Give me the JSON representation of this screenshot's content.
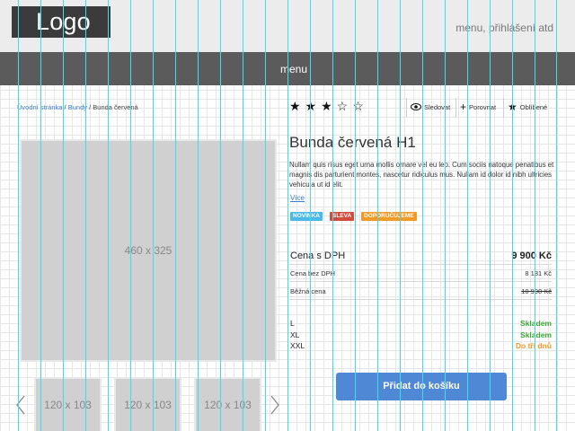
{
  "header": {
    "logo": "Logo",
    "right_text": "menu, přihlášení atd"
  },
  "menu": {
    "label": "menu"
  },
  "breadcrumb": {
    "home": "Úvodní stránka",
    "sep1": " / ",
    "category": "Bundy",
    "sep2": " / ",
    "current": "Bunda červená"
  },
  "gallery": {
    "main_placeholder": "460 x 325",
    "thumbs": [
      "120 x 103",
      "120 x 103",
      "120 x 103"
    ],
    "prev_icon": "chevron-left-icon",
    "next_icon": "chevron-right-icon"
  },
  "rating": {
    "stars": "★★★☆☆",
    "value": 3,
    "max": 5
  },
  "actions": {
    "watch": "Sledovat",
    "compare": "Porovnat",
    "favorite": "Oblíbené"
  },
  "product": {
    "title": "Bunda červená H1",
    "description": "Nullam quis risus eget urna mollis ornare vel eu leo. Cum sociis natoque penatibus et magnis dis parturient montes, nascetur ridiculus mus. Nullam id dolor id nibh ultricies vehicula ut id elit.",
    "more_link": "Více",
    "badges": [
      {
        "label": "NOVINKA",
        "color": "#4bb8e8"
      },
      {
        "label": "SLEVA",
        "color": "#d24b3c"
      },
      {
        "label": "DOPORUČUJEME",
        "color": "#f09a27"
      }
    ]
  },
  "prices": {
    "with_vat_label": "Cena s DPH",
    "with_vat": "9 900 Kč",
    "without_vat_label": "Cena bez DPH",
    "without_vat": "8 181 Kč",
    "regular_label": "Běžná cena",
    "regular": "10 990 Kč"
  },
  "sizes": [
    {
      "size": "L",
      "status": "Skladem",
      "color": "#3aa533"
    },
    {
      "size": "XL",
      "status": "Skladem",
      "color": "#3aa533"
    },
    {
      "size": "XXL",
      "status": "Do tří dnů",
      "color": "#f09a27"
    }
  ],
  "cart": {
    "button_label": "Přidat do košíku"
  },
  "colors": {
    "guide": "#3fdde8",
    "accent": "#4f89d6",
    "link": "#3a7fcf"
  }
}
